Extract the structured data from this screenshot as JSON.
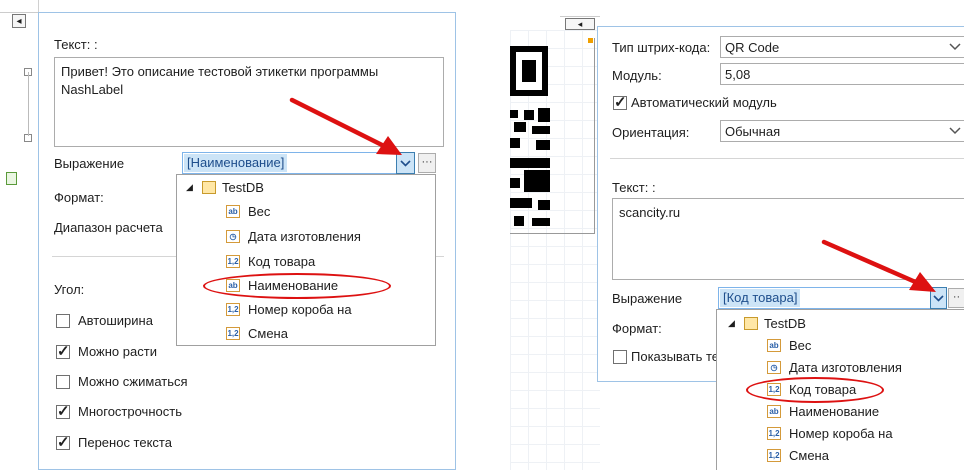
{
  "left": {
    "text_label": "Текст: :",
    "text_value": "Привет! Это описание тестовой этикетки программы NashLabel",
    "expression_label": "Выражение",
    "expression_value": "[Наименование]",
    "format_label": "Формат:",
    "range_label": "Диапазон расчета",
    "angle_label": "Угол:",
    "checkboxes": [
      {
        "label": "Автоширина",
        "checked": false
      },
      {
        "label": "Можно расти",
        "checked": true
      },
      {
        "label": "Можно сжиматься",
        "checked": false
      },
      {
        "label": "Многострочность",
        "checked": true
      },
      {
        "label": "Перенос текста",
        "checked": true
      }
    ],
    "tree": {
      "root": "TestDB",
      "items": [
        {
          "label": "Вес",
          "icon": "ab"
        },
        {
          "label": "Дата изготовления",
          "icon": "clock"
        },
        {
          "label": "Код товара",
          "icon": "1,2"
        },
        {
          "label": "Наименование",
          "icon": "ab"
        },
        {
          "label": "Номер короба на",
          "icon": "1,2"
        },
        {
          "label": "Смена",
          "icon": "1,2"
        }
      ]
    }
  },
  "right": {
    "barcode_type_label": "Тип штрих-кода:",
    "barcode_type_value": "QR Code",
    "module_label": "Модуль:",
    "module_value": "5,08",
    "auto_module_label": "Автоматический модуль",
    "auto_module_checked": true,
    "orientation_label": "Ориентация:",
    "orientation_value": "Обычная",
    "text_label": "Текст: :",
    "text_value": "scancity.ru",
    "expression_label": "Выражение",
    "expression_value": "[Код товара]",
    "format_label": "Формат:",
    "show_text_label": "Показывать те",
    "tree": {
      "root": "TestDB",
      "items": [
        {
          "label": "Вес",
          "icon": "ab"
        },
        {
          "label": "Дата изготовления",
          "icon": "clock"
        },
        {
          "label": "Код товара",
          "icon": "1,2"
        },
        {
          "label": "Наименование",
          "icon": "ab"
        },
        {
          "label": "Номер короба на",
          "icon": "1,2"
        },
        {
          "label": "Смена",
          "icon": "1,2"
        }
      ]
    }
  },
  "colors": {
    "accent": "#3c7fb1",
    "highlight": "#cce4f7",
    "annotation": "#dd1111",
    "panel_border": "#9ec3e6"
  },
  "icons": {
    "ellipsis": "···",
    "dropdown": "chevron-down-icon",
    "collapse": "◢"
  }
}
